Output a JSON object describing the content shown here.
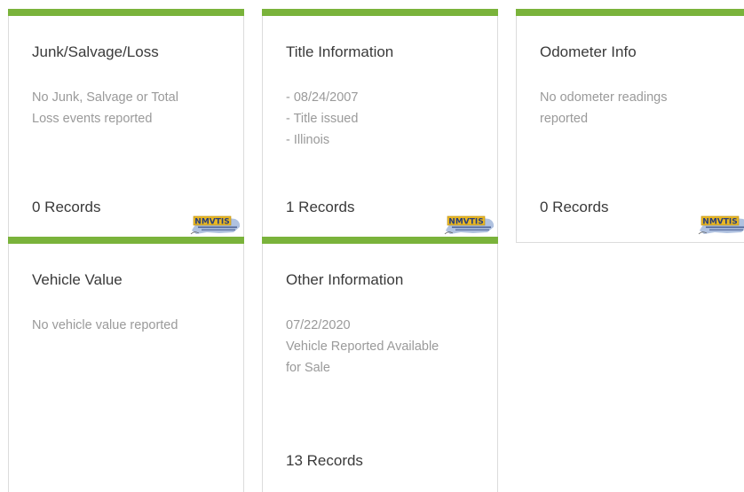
{
  "colors": {
    "accent": "#7ab33b",
    "title_text": "#3a3a3a",
    "body_text": "#9a9a9a",
    "border": "#dcdcdc",
    "logo_gold": "#e9b824",
    "logo_blue": "#6f8fc7"
  },
  "cards": [
    {
      "title": "Junk/Salvage/Loss",
      "body": [
        "No Junk, Salvage or Total",
        "Loss events reported"
      ],
      "records": "0 Records",
      "logo": "nmvtis-logo"
    },
    {
      "title": "Title Information",
      "body": [
        "- 08/24/2007",
        "- Title issued",
        "- Illinois"
      ],
      "records": "1 Records",
      "logo": "nmvtis-logo"
    },
    {
      "title": "Odometer Info",
      "body": [
        "No odometer readings",
        "reported"
      ],
      "records": "0 Records",
      "logo": "nmvtis-logo"
    },
    {
      "title": "Vehicle Value",
      "body": [
        "No vehicle value reported"
      ]
    },
    {
      "title": "Other Information",
      "body": [
        "07/22/2020",
        "Vehicle Reported Available",
        "for Sale"
      ],
      "records": "13 Records"
    }
  ]
}
